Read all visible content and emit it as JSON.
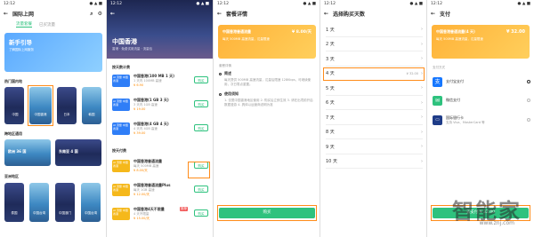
{
  "status": {
    "time": "12:12",
    "icons": "● ▲ ■"
  },
  "panel1": {
    "title": "国际上网",
    "tabs": [
      "流量套餐",
      "已买流量"
    ],
    "banner": "新手引导",
    "banner_sub": "了解国际上网服务",
    "section_hot": "热门国内地",
    "hot": [
      "中国",
      "中国香港",
      "日本",
      "韩国"
    ],
    "section_cross": "跨地区通用",
    "cross": [
      "欧洲 36 国",
      "东南亚 4 国"
    ],
    "section_asia": "亚洲地区",
    "asia": [
      "泰国",
      "中国台湾",
      "中国澳门",
      "中国台湾"
    ]
  },
  "panel2": {
    "hero_title": "中国香港",
    "hero_sub": "香港 · 免费试用流量 · 流量包",
    "section_day": "按天数计费",
    "day_items": [
      {
        "tag": "AI 流量 中国香港",
        "name": "中国香港(100 MB 1 天)",
        "desc": "1 天内 100MB 高速",
        "price": "¥ 6.90",
        "btn": "购买"
      },
      {
        "tag": "AI 流量 中国香港",
        "name": "中国香港(1 GB 3 天)",
        "desc": "3 天内 1GB 高速",
        "price": "¥ 19.00",
        "btn": "购买"
      },
      {
        "tag": "AI 流量 中国香港",
        "name": "中国香港(4 GB 4 天)",
        "desc": "4 天内 4GB 高速",
        "price": "¥ 39.00",
        "btn": "购买"
      }
    ],
    "section_pkg": "按天付费",
    "pkg_items": [
      {
        "tag": "AI 流量 中国香港",
        "name": "中国香港普通流量",
        "desc": "每天 500MB 高速",
        "price": "¥ 8.00/天",
        "btn": "购买"
      },
      {
        "tag": "AI 流量 中国香港",
        "name": "中国香港普通流量Plus",
        "desc": "每天 1GB 高速",
        "price": "¥ 12.00/天",
        "btn": "购买"
      },
      {
        "tag": "AI 流量 中国香港",
        "name": "中国香港4天不限量",
        "badge": "推荐",
        "desc": "4 天不限量",
        "price": "¥ 15.00/天",
        "btn": "购买"
      }
    ]
  },
  "panel3": {
    "title": "套餐详情",
    "card_title": "中国香港普通流量",
    "card_price": "¥ 8.00/天",
    "card_sub": "每天 500MB 高速流量，达量限速",
    "section_label": "套餐详情",
    "item1_title": "简述",
    "item1_text": "每天提供 500MB 高速流量，达量后限速 128Kbps，可继续使用，次日零点重置。",
    "item2_title": "使用须知",
    "item2_text": "1. 仅限中国香港地区使用 2. 购买后立即生效 3. 请在出境前开启数据漫游 4. 具体以运营商说明为准",
    "button": "购买"
  },
  "panel4": {
    "title": "选择购买天数",
    "days": [
      "1 天",
      "2 天",
      "3 天",
      "4 天",
      "5 天",
      "6 天",
      "7 天",
      "8 天",
      "9 天",
      "10 天"
    ],
    "selected_price": "¥ 32.00"
  },
  "panel5": {
    "title": "支付",
    "card_title": "中国香港普通流量(4 天)",
    "card_price": "¥ 32.00",
    "card_sub": "每天 500MB 高速流量，达量限速",
    "section_label": "支付方式",
    "methods": [
      {
        "name": "支付宝支付",
        "sub": "",
        "selected": true
      },
      {
        "name": "微信支付",
        "sub": "",
        "selected": false
      },
      {
        "name": "国际银行卡",
        "sub": "支持 Visa、MasterCard 等",
        "selected": false
      }
    ],
    "pay_button": "去支付 ¥ 32.00"
  },
  "watermark": {
    "brand": "智能家",
    "url": "www.znj.com"
  }
}
